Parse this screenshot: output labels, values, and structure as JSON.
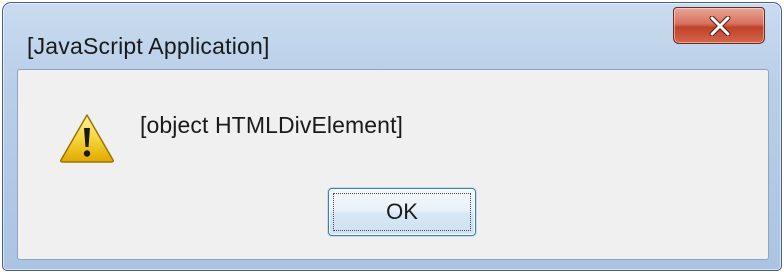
{
  "window": {
    "title": "[JavaScript Application]"
  },
  "dialog": {
    "icon": "warning-icon",
    "message": "[object HTMLDivElement]",
    "ok_label": "OK"
  },
  "colors": {
    "frame": "#b9cfe8",
    "close_button": "#c1412a",
    "client": "#f0f0f0",
    "ok_border": "#3c7fb1"
  }
}
